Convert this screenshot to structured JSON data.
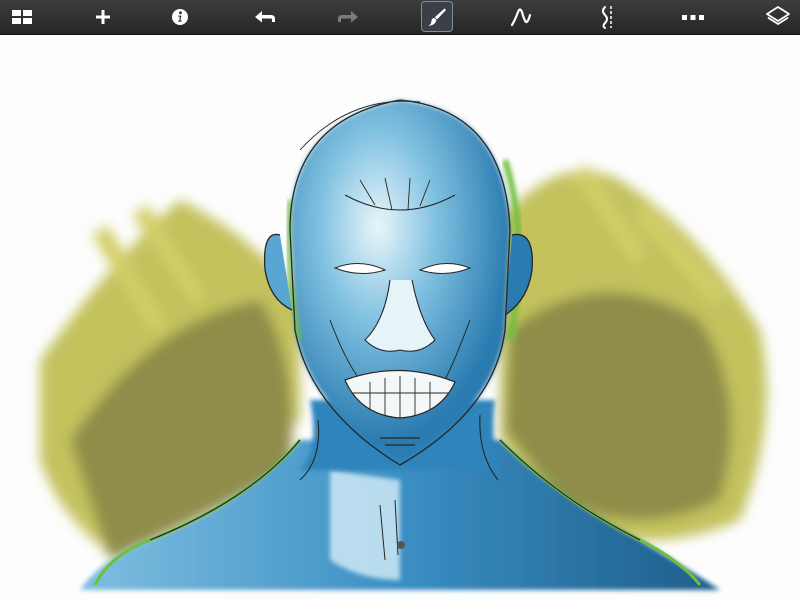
{
  "app": {
    "name": ""
  },
  "toolbar": {
    "items": [
      {
        "id": "gallery",
        "icon": "grid-icon",
        "state": "enabled"
      },
      {
        "id": "new",
        "icon": "plus-icon",
        "state": "enabled"
      },
      {
        "id": "info",
        "icon": "info-icon",
        "state": "enabled"
      },
      {
        "id": "undo",
        "icon": "undo-icon",
        "state": "enabled"
      },
      {
        "id": "redo",
        "icon": "redo-icon",
        "state": "disabled"
      },
      {
        "id": "brush",
        "icon": "brush-icon",
        "state": "selected"
      },
      {
        "id": "stroke",
        "icon": "curve-stroke-icon",
        "state": "enabled"
      },
      {
        "id": "symmetry",
        "icon": "symmetry-icon",
        "state": "enabled"
      },
      {
        "id": "more",
        "icon": "more-icon",
        "state": "enabled"
      },
      {
        "id": "layers",
        "icon": "layers-icon",
        "state": "enabled"
      }
    ],
    "colors": {
      "icon": "#ffffff",
      "disabled": "#7a7a7a",
      "selected_border": "#7e8ea3"
    }
  },
  "canvas": {
    "content": "painting",
    "colors": {
      "skin": "#3a8fc4",
      "skin_dark": "#1f5f8c",
      "highlight": "#dceff8",
      "background_paint": "#b6b53a",
      "background_dark": "#7c7a2c",
      "accent": "#6fbf3d",
      "line": "#262626"
    }
  }
}
